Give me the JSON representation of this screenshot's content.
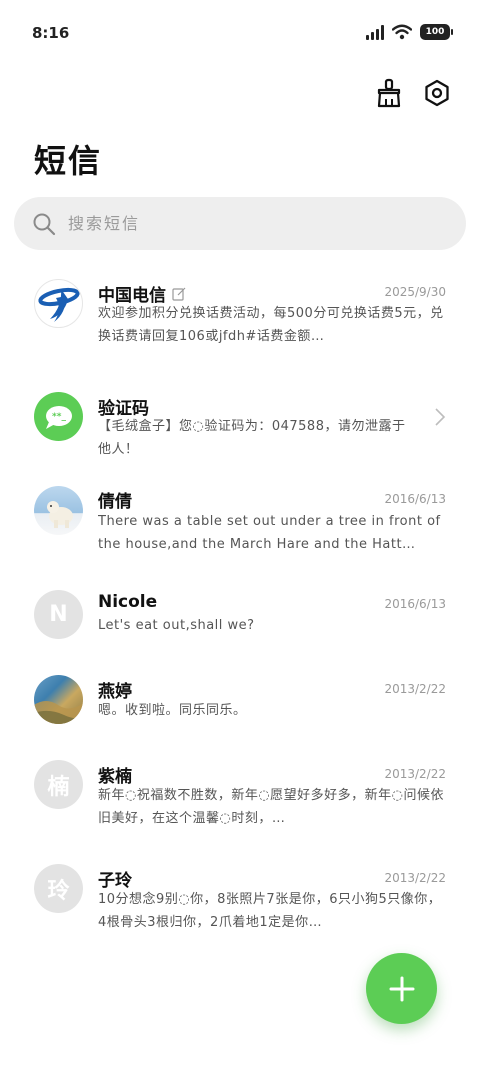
{
  "status": {
    "time": "8:16",
    "battery": "100"
  },
  "header": {
    "title": "短信"
  },
  "search": {
    "placeholder": "搜索短信"
  },
  "conversations": [
    {
      "name": "中国电信",
      "date": "2025/9/30",
      "preview": "欢迎参加积分兑换话费活动，每500分可兑换话费5元，兑换话费请回复106或jfdh#话费金额…",
      "avatar": "telecom-logo"
    },
    {
      "name": "验证码",
      "date": "",
      "preview": "【毛绒盒子】您◌验证码为：047588，请勿泄露于他人！",
      "avatar": "verify-chat-icon"
    },
    {
      "name": "倩倩",
      "date": "2016/6/13",
      "preview": "There was a table set out under a tree in front of the house,and the March Hare and the Hatt…",
      "avatar": "polar-bear-photo"
    },
    {
      "name": "Nicole",
      "date": "2016/6/13",
      "preview": "Let's eat out,shall we?",
      "avatar_letter": "N"
    },
    {
      "name": "燕婷",
      "date": "2013/2/22",
      "preview": "嗯。收到啦。同乐同乐。",
      "avatar": "landscape-photo"
    },
    {
      "name": "紫楠",
      "date": "2013/2/22",
      "preview": "新年◌祝福数不胜数，新年◌愿望好多好多，新年◌问候依旧美好，在这个温馨◌时刻，…",
      "avatar_letter": "楠"
    },
    {
      "name": "子玲",
      "date": "2013/2/22",
      "preview": "10分想念9别◌你，8张照片7张是你，6只小狗5只像你，4根骨头3根归你，2爪着地1定是你…",
      "avatar_letter": "玲"
    }
  ],
  "colors": {
    "accent": "#5ccd55",
    "telecom_blue": "#1a5fb4"
  }
}
